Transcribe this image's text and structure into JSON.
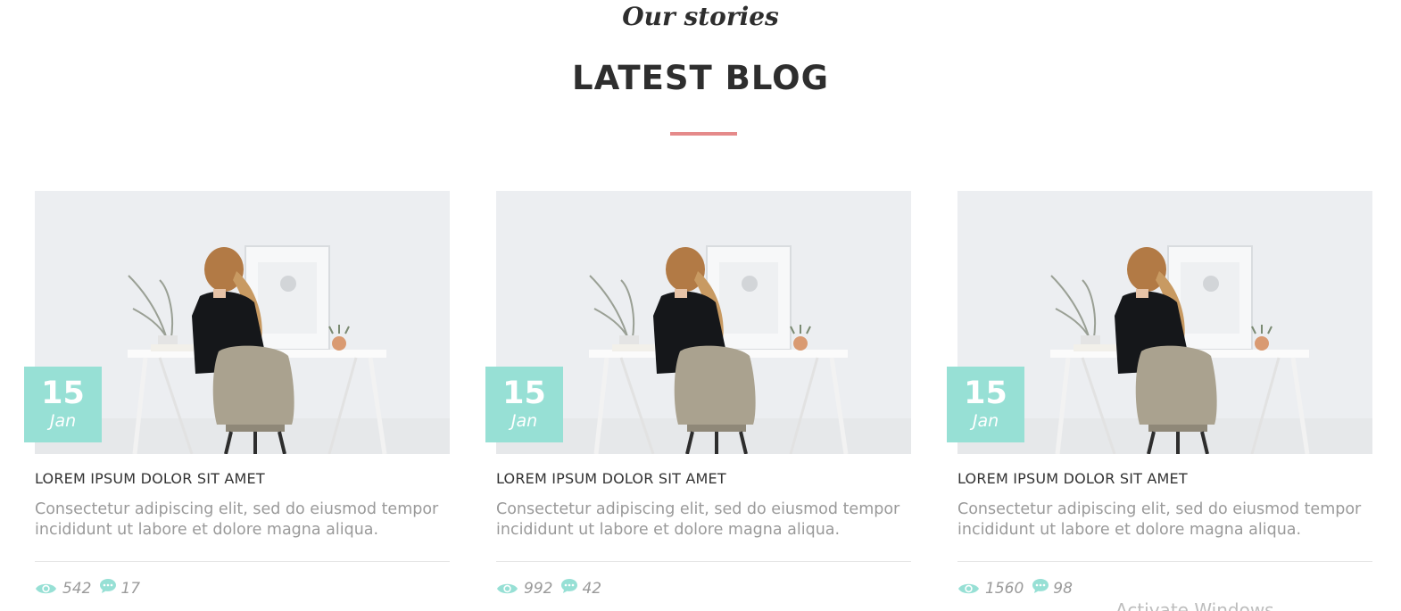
{
  "section": {
    "kicker": "Our stories",
    "title": "LATEST BLOG",
    "divider_color": "#e58a8a"
  },
  "posts": [
    {
      "date": {
        "day": "15",
        "month": "Jan"
      },
      "title": "LOREM IPSUM DOLOR SIT AMET",
      "excerpt": "Consectetur adipiscing elit, sed do eiusmod tempor incididunt ut labore et dolore magna aliqua.",
      "views": "542",
      "comments": "17",
      "image_icon": "woman-at-desk-photo"
    },
    {
      "date": {
        "day": "15",
        "month": "Jan"
      },
      "title": "LOREM IPSUM DOLOR SIT AMET",
      "excerpt": "Consectetur adipiscing elit, sed do eiusmod tempor incididunt ut labore et dolore magna aliqua.",
      "views": "992",
      "comments": "42",
      "image_icon": "woman-at-desk-photo"
    },
    {
      "date": {
        "day": "15",
        "month": "Jan"
      },
      "title": "LOREM IPSUM DOLOR SIT AMET",
      "excerpt": "Consectetur adipiscing elit, sed do eiusmod tempor incididunt ut labore et dolore magna aliqua.",
      "views": "1560",
      "comments": "98",
      "image_icon": "woman-at-desk-photo"
    }
  ],
  "icons": {
    "views": "eye-icon",
    "comments": "comment-icon"
  },
  "colors": {
    "badge": "#97e0d5",
    "icon": "#97e0d5",
    "muted_text": "#9a9a9a"
  },
  "watermark": "Activate Windows"
}
